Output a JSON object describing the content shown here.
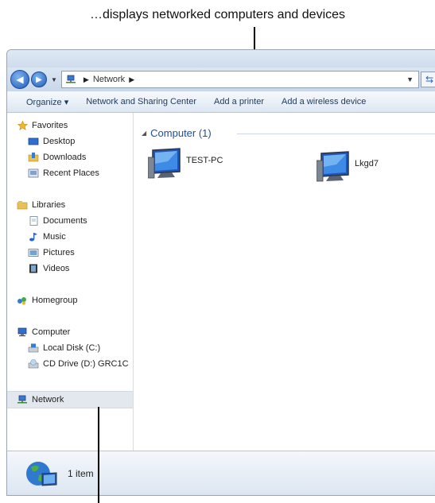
{
  "annotations": {
    "top": "…displays networked computers and devices"
  },
  "address": {
    "segments": [
      "Network"
    ]
  },
  "toolbar": {
    "organize": "Organize ▾",
    "network_sharing": "Network and Sharing Center",
    "add_printer": "Add a printer",
    "add_wireless": "Add a wireless device"
  },
  "nav": {
    "favorites": "Favorites",
    "desktop": "Desktop",
    "downloads": "Downloads",
    "recent_places": "Recent Places",
    "libraries": "Libraries",
    "documents": "Documents",
    "music": "Music",
    "pictures": "Pictures",
    "videos": "Videos",
    "homegroup": "Homegroup",
    "computer": "Computer",
    "local_disk": "Local Disk (C:)",
    "cd_drive": "CD Drive (D:) GRC1C",
    "network": "Network"
  },
  "main": {
    "group_header": "Computer (1)",
    "items": [
      {
        "name": "TEST-PC"
      },
      {
        "name": "Lkgd7"
      }
    ]
  },
  "status": {
    "count": "1 item"
  },
  "colors": {
    "link_blue": "#1e4e9c",
    "toolbar_text": "#1e3a5f"
  }
}
